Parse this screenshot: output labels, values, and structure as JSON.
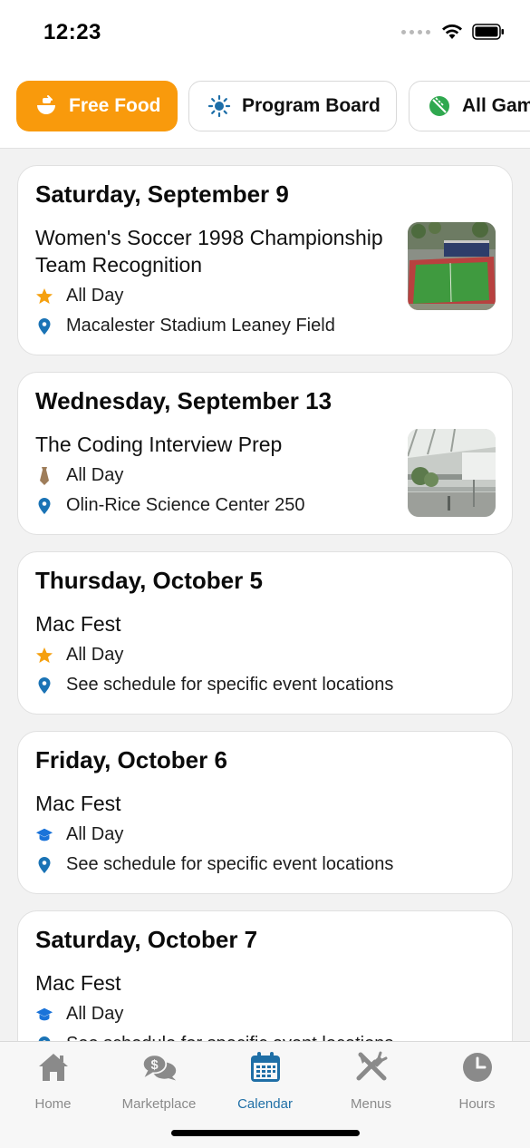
{
  "status_bar": {
    "time": "12:23"
  },
  "chips": [
    {
      "label": "Free Food",
      "icon": "food-bowl-icon",
      "active": true
    },
    {
      "label": "Program Board",
      "icon": "sun-icon",
      "active": false
    },
    {
      "label": "All Gam",
      "icon": "sports-balls-icon",
      "active": false
    }
  ],
  "events": [
    {
      "date": "Saturday, September 9",
      "title": "Women's Soccer 1998 Championship Team Recognition",
      "time": "All Day",
      "category_icon": "star-icon",
      "location": "Macalester Stadium Leaney Field",
      "thumbnail": "stadium-photo"
    },
    {
      "date": "Wednesday, September 13",
      "title": "The Coding Interview Prep",
      "time": "All Day",
      "category_icon": "tie-icon",
      "location": "Olin-Rice Science Center 250",
      "thumbnail": "atrium-photo"
    },
    {
      "date": "Thursday, October 5",
      "title": "Mac Fest",
      "time": "All Day",
      "category_icon": "star-icon",
      "location": "See schedule for specific event locations"
    },
    {
      "date": "Friday, October 6",
      "title": "Mac Fest",
      "time": "All Day",
      "category_icon": "graduation-cap-icon",
      "location": "See schedule for specific event locations"
    },
    {
      "date": "Saturday, October 7",
      "title": "Mac Fest",
      "time": "All Day",
      "category_icon": "graduation-cap-icon",
      "location": "See schedule for specific event locations"
    }
  ],
  "tabs": [
    {
      "label": "Home",
      "icon": "house-icon",
      "active": false
    },
    {
      "label": "Marketplace",
      "icon": "money-chat-icon",
      "active": false
    },
    {
      "label": "Calendar",
      "icon": "calendar-icon",
      "active": true
    },
    {
      "label": "Menus",
      "icon": "utensils-icon",
      "active": false
    },
    {
      "label": "Hours",
      "icon": "clock-icon",
      "active": false
    }
  ],
  "colors": {
    "accent_orange": "#f99a0c",
    "active_blue": "#1f6fa6",
    "pin_blue": "#1a73b5",
    "inactive_gray": "#8a8a8a"
  }
}
